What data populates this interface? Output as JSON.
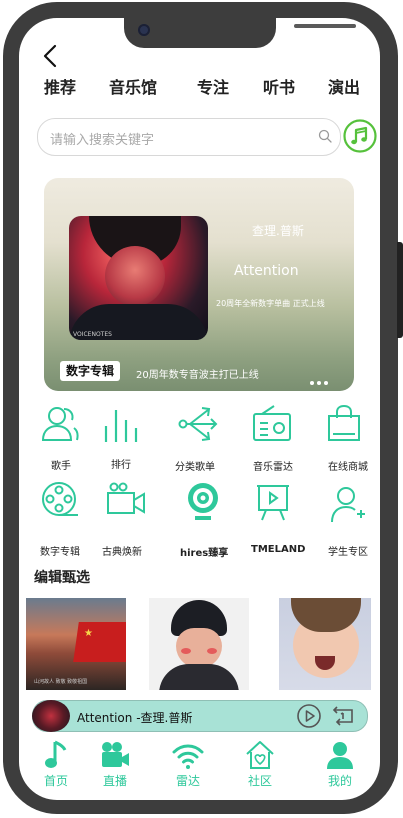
{
  "top_tabs": [
    "推荐",
    "音乐馆",
    "专注",
    "听书",
    "演出"
  ],
  "search": {
    "placeholder": "请输入搜索关键字"
  },
  "banner": {
    "artist": "查理.普斯",
    "song": "Attention",
    "promo": "20周年全新数字单曲  正式上线",
    "badge": "数字专辑",
    "caption": "20周年数专音波主打已上线",
    "cover_tag": "VOICENOTES"
  },
  "grid_row1": [
    {
      "label": "歌手",
      "icon": "singer-icon"
    },
    {
      "label": "排行",
      "icon": "ranking-icon"
    },
    {
      "label": "分类歌单",
      "icon": "category-playlist-icon"
    },
    {
      "label": "音乐雷达",
      "icon": "radio-icon"
    },
    {
      "label": "在线商城",
      "icon": "shopping-bag-icon"
    }
  ],
  "grid_row2": [
    {
      "label": "数字专辑",
      "icon": "film-reel-icon"
    },
    {
      "label": "古典焕新",
      "icon": "video-camera-icon"
    },
    {
      "label": "hires臻享",
      "icon": "webcam-icon"
    },
    {
      "label": "TMELAND",
      "icon": "presentation-icon"
    },
    {
      "label": "学生专区",
      "icon": "add-user-icon"
    }
  ],
  "section_title": "编辑甄选",
  "thumb1_caption": "山河故人 致敬 致敬祖国",
  "player": {
    "title": "Attention  -查理.普斯"
  },
  "bottom_nav": [
    {
      "label": "首页",
      "icon": "music-note-icon"
    },
    {
      "label": "直播",
      "icon": "video-camera-icon"
    },
    {
      "label": "雷达",
      "icon": "wifi-icon"
    },
    {
      "label": "社区",
      "icon": "home-heart-icon"
    },
    {
      "label": "我的",
      "icon": "user-icon"
    }
  ],
  "colors": {
    "accent": "#2ec89b",
    "player_bg": "#a8e2d6",
    "frame": "#3d3d3d"
  }
}
